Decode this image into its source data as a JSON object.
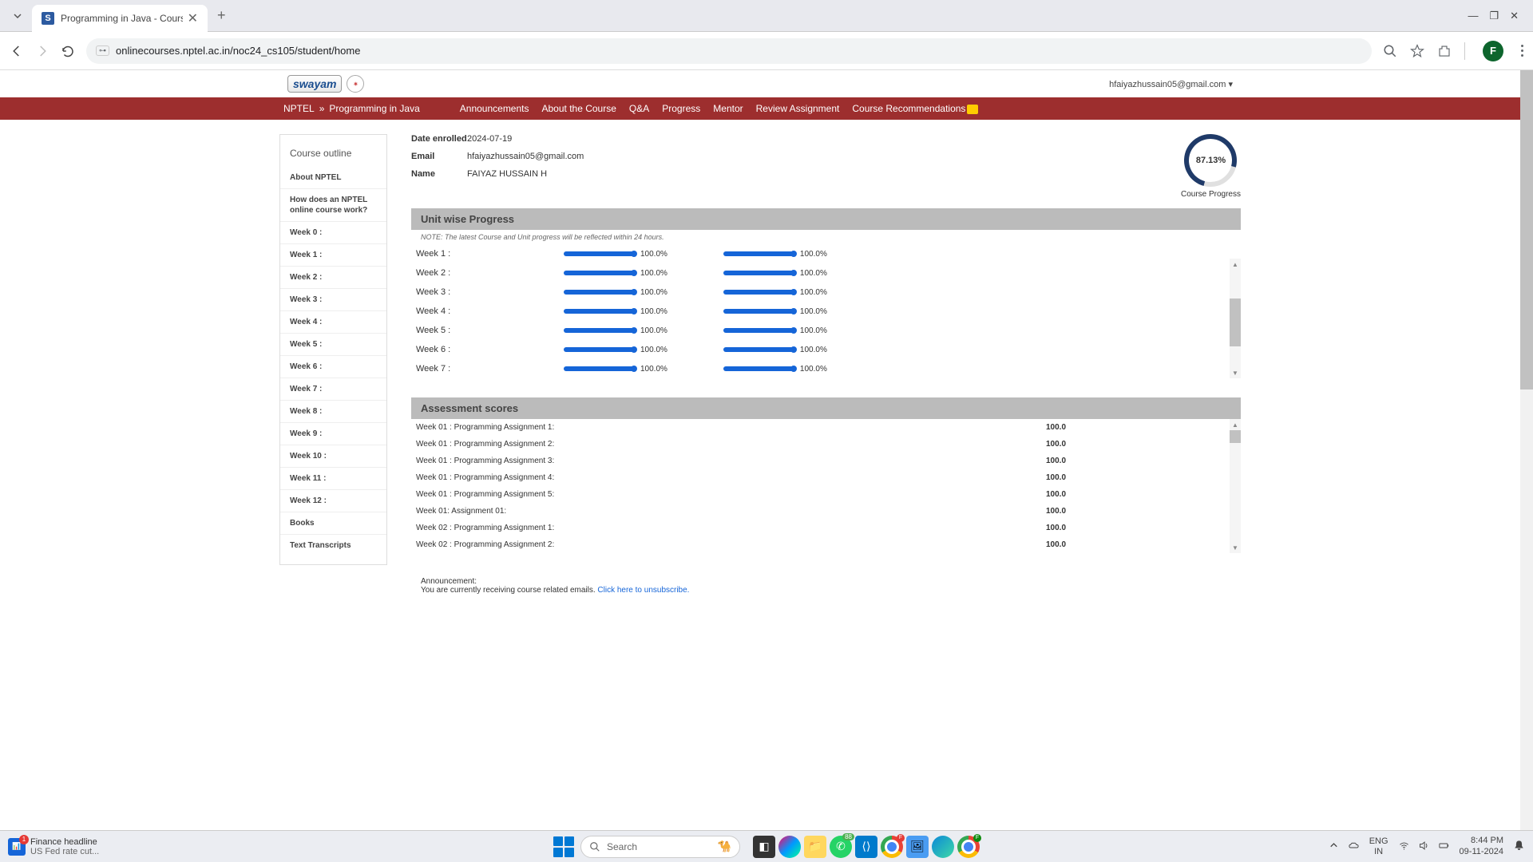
{
  "browser": {
    "tab_title": "Programming in Java - Course ",
    "url": "onlinecourses.nptel.ac.in/noc24_cs105/student/home",
    "profile_letter": "F"
  },
  "header": {
    "logo_text": "swayam",
    "user_email": "hfaiyazhussain05@gmail.com"
  },
  "nav": {
    "crumb1": "NPTEL",
    "crumb_sep": "»",
    "crumb2": "Programming in Java",
    "links": [
      "Announcements",
      "About the Course",
      "Q&A",
      "Progress",
      "Mentor",
      "Review Assignment",
      "Course Recommendations"
    ]
  },
  "sidebar": {
    "title": "Course outline",
    "items": [
      "About NPTEL",
      "How does an NPTEL online course work?",
      "Week 0 :",
      "Week 1 :",
      "Week 2 :",
      "Week 3 :",
      "Week 4 :",
      "Week 5 :",
      "Week 6 :",
      "Week 7 :",
      "Week 8 :",
      "Week 9 :",
      "Week 10 :",
      "Week 11 :",
      "Week 12 :",
      "Books",
      "Text Transcripts"
    ]
  },
  "info": {
    "date_label": "Date enrolled",
    "date_value": "2024-07-19",
    "email_label": "Email",
    "email_value": "hfaiyazhussain05@gmail.com",
    "name_label": "Name",
    "name_value": "FAIYAZ HUSSAIN H"
  },
  "progress_ring": {
    "percent": "87.13%",
    "label": "Course Progress"
  },
  "unit_section": {
    "title": "Unit wise Progress",
    "note": "NOTE: The latest Course and Unit progress will be reflected within 24 hours.",
    "rows": [
      {
        "name": "Week 1 :",
        "p1": "100.0%",
        "p2": "100.0%"
      },
      {
        "name": "Week 2 :",
        "p1": "100.0%",
        "p2": "100.0%"
      },
      {
        "name": "Week 3 :",
        "p1": "100.0%",
        "p2": "100.0%"
      },
      {
        "name": "Week 4 :",
        "p1": "100.0%",
        "p2": "100.0%"
      },
      {
        "name": "Week 5 :",
        "p1": "100.0%",
        "p2": "100.0%"
      },
      {
        "name": "Week 6 :",
        "p1": "100.0%",
        "p2": "100.0%"
      },
      {
        "name": "Week 7 :",
        "p1": "100.0%",
        "p2": "100.0%"
      }
    ]
  },
  "assess_section": {
    "title": "Assessment scores",
    "rows": [
      {
        "name": "Week 01 : Programming Assignment 1:",
        "score": "100.0"
      },
      {
        "name": "Week 01 : Programming Assignment 2:",
        "score": "100.0"
      },
      {
        "name": "Week 01 : Programming Assignment 3:",
        "score": "100.0"
      },
      {
        "name": "Week 01 : Programming Assignment 4:",
        "score": "100.0"
      },
      {
        "name": "Week 01 : Programming Assignment 5:",
        "score": "100.0"
      },
      {
        "name": "Week 01: Assignment 01:",
        "score": "100.0"
      },
      {
        "name": "Week 02 : Programming Assignment 1:",
        "score": "100.0"
      },
      {
        "name": "Week 02 : Programming Assignment 2:",
        "score": "100.0"
      }
    ]
  },
  "announce": {
    "label": "Announcement:",
    "text": "You are currently receiving course related emails. ",
    "link": "Click here to unsubscribe."
  },
  "taskbar": {
    "widget_title": "Finance headline",
    "widget_sub": "US Fed rate cut...",
    "widget_badge": "1",
    "search_placeholder": "Search",
    "whatsapp_badge": "88",
    "lang1": "ENG",
    "lang2": "IN",
    "time": "8:44 PM",
    "date": "09-11-2024"
  }
}
